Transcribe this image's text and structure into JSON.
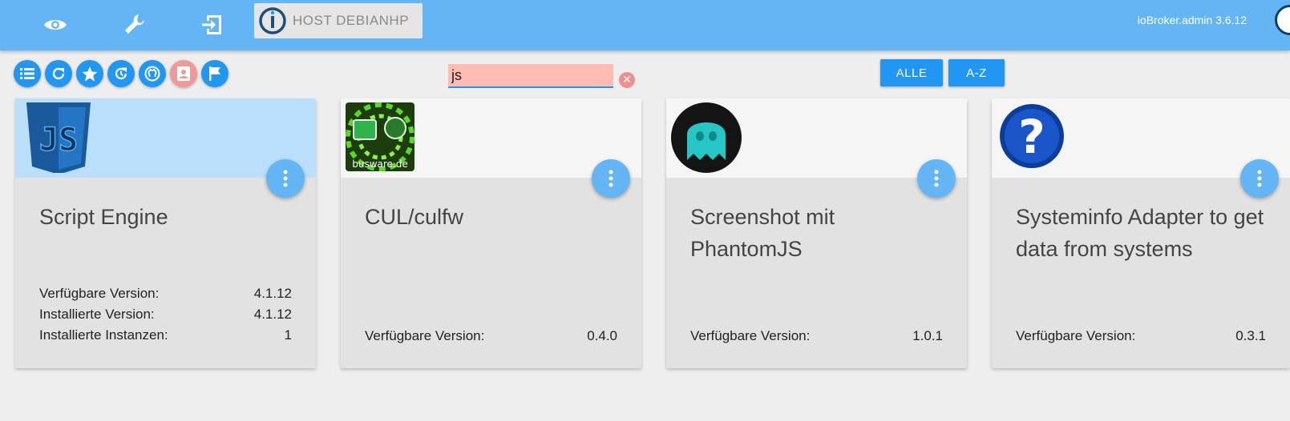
{
  "topbar": {
    "nav": [
      "eye-icon",
      "wrench-icon",
      "login-icon"
    ],
    "host_name": "HOST DEBIANHP",
    "version": "ioBroker.admin 3.6.12",
    "colors": {
      "bar": "#64b5f6",
      "host_box": "#e5e5e5"
    }
  },
  "toolbar": {
    "icons": [
      "list-icon",
      "refresh-icon",
      "star-icon",
      "update-icon",
      "github-icon",
      "contact-icon",
      "flag-icon"
    ]
  },
  "search": {
    "value": "js"
  },
  "filters": {
    "all_label": "ALLE",
    "sort_label": "A-Z"
  },
  "cards": [
    {
      "title": "Script Engine",
      "icon": "javascript-logo-icon",
      "rows": [
        {
          "label": "Verfügbare Version:",
          "value": "4.1.12"
        },
        {
          "label": "Installierte Version:",
          "value": "4.1.12"
        },
        {
          "label": "Installierte Instanzen:",
          "value": "1"
        }
      ]
    },
    {
      "title": "CUL/culfw",
      "icon": "busware-logo-icon",
      "icon_text": "busware.de",
      "rows": [
        {
          "label": "Verfügbare Version:",
          "value": "0.4.0"
        }
      ]
    },
    {
      "title": "Screenshot mit PhantomJS",
      "icon": "ghost-logo-icon",
      "rows": [
        {
          "label": "Verfügbare Version:",
          "value": "1.0.1"
        }
      ]
    },
    {
      "title": "Systeminfo Adapter to get data from systems",
      "icon": "question-mark-icon",
      "rows": [
        {
          "label": "Verfügbare Version:",
          "value": "0.3.1"
        }
      ]
    }
  ]
}
